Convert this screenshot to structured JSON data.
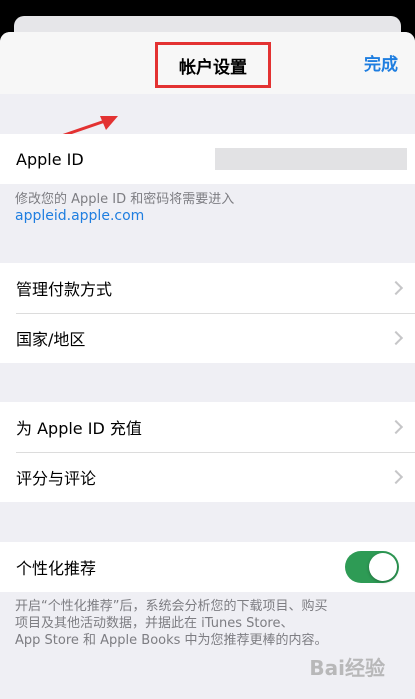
{
  "nav": {
    "title": "帐户设置",
    "done_label": "完成"
  },
  "apple_id_section": {
    "label": "Apple ID",
    "footnote_text": "修改您的 Apple ID 和密码将需要进入",
    "footnote_link": "appleid.apple.com"
  },
  "payment_section": {
    "items": [
      {
        "label": "管理付款方式"
      },
      {
        "label": "国家/地区"
      }
    ]
  },
  "topup_section": {
    "items": [
      {
        "label": "为 Apple ID 充值"
      },
      {
        "label": "评分与评论"
      }
    ]
  },
  "personalized": {
    "label": "个性化推荐",
    "enabled": true,
    "footnote_line1": "开启“个性化推荐”后，系统会分析您的下载项目、购买",
    "footnote_line2": "项目及其他活动数据，并据此在 iTunes Store、",
    "footnote_line3": "App Store 和 Apple Books 中为您推荐更棒的内容。"
  },
  "colors": {
    "accent": "#1f7ee0",
    "toggle_on": "#2e9b55",
    "highlight": "#e33232"
  },
  "watermark": "Bai经验"
}
